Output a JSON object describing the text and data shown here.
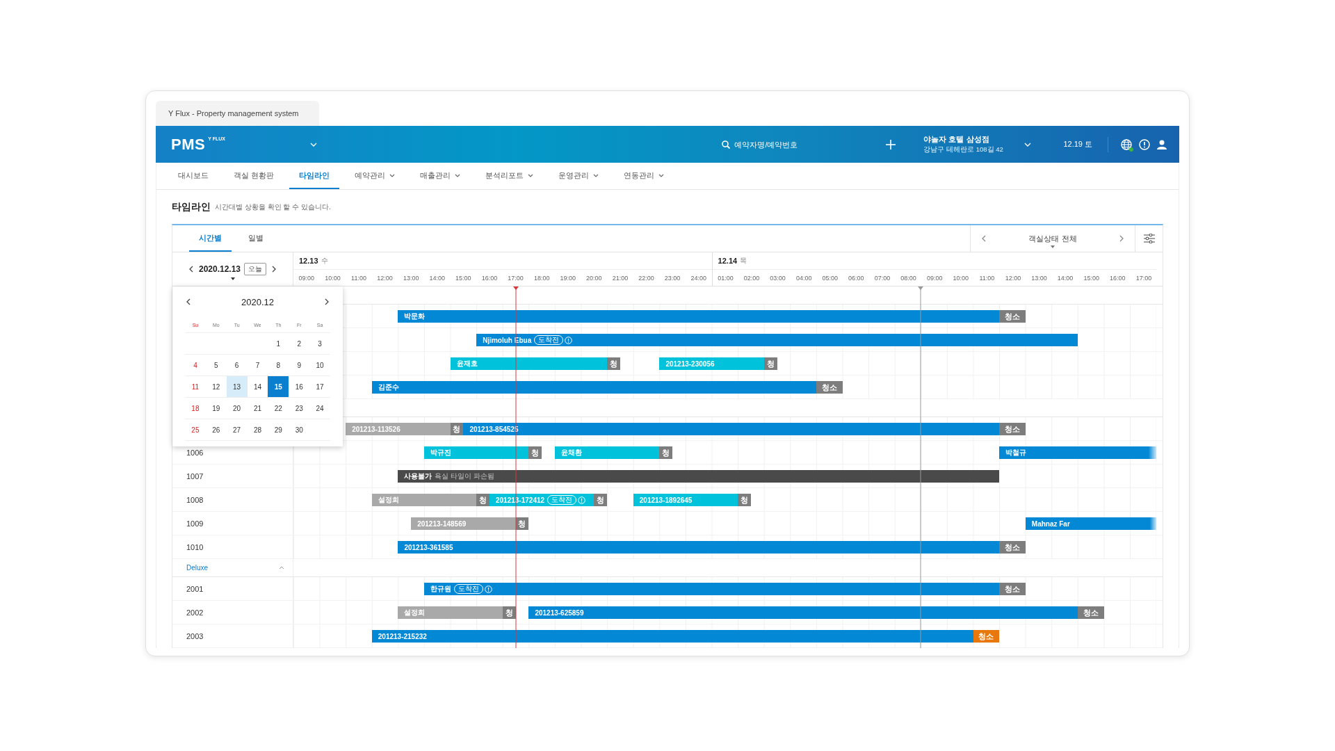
{
  "browser_tab": {
    "title": "Y Flux - Property management system"
  },
  "header": {
    "logo": "PMS",
    "logo_sub": "Y FLUX",
    "search": {
      "placeholder": "예약자명/예약번호"
    },
    "hotel": {
      "name": "야놀자 호텔 삼성점",
      "address": "강남구 테헤란로 108길 42"
    },
    "date": "12.19 토",
    "online": true
  },
  "nav": [
    {
      "label": "대시보드",
      "selected": false,
      "dropdown": false
    },
    {
      "label": "객실 현황판",
      "selected": false,
      "dropdown": false
    },
    {
      "label": "타임라인",
      "selected": true,
      "dropdown": false
    },
    {
      "label": "예약관리",
      "selected": false,
      "dropdown": true
    },
    {
      "label": "매출관리",
      "selected": false,
      "dropdown": true
    },
    {
      "label": "분석리포트",
      "selected": false,
      "dropdown": true
    },
    {
      "label": "운영관리",
      "selected": false,
      "dropdown": true
    },
    {
      "label": "연동관리",
      "selected": false,
      "dropdown": true
    }
  ],
  "page": {
    "title": "타임라인",
    "subtitle": "시간대별 상황을 확인 할 수 있습니다."
  },
  "view_tabs": [
    {
      "label": "시간별",
      "selected": true
    },
    {
      "label": "일별",
      "selected": false
    }
  ],
  "room_status_filter": {
    "label": "객실상태 전체"
  },
  "date_picker": {
    "date": "2020.12.13",
    "today_badge": "오늘",
    "calendar": {
      "month": "2020.12",
      "weekdays": [
        "Su",
        "Mo",
        "Tu",
        "We",
        "Th",
        "Fr",
        "Sa"
      ],
      "weeks": [
        [
          {
            "day": "1",
            "today": false,
            "selected": false
          },
          {
            "day": "2",
            "today": false,
            "selected": false
          },
          {
            "day": "3",
            "today": false,
            "selected": false
          }
        ],
        [
          {
            "day": "4",
            "today": false,
            "selected": false
          },
          {
            "day": "5",
            "today": false,
            "selected": false
          },
          {
            "day": "6",
            "today": false,
            "selected": false
          },
          {
            "day": "7",
            "today": false,
            "selected": false
          },
          {
            "day": "8",
            "today": false,
            "selected": false
          },
          {
            "day": "9",
            "today": false,
            "selected": false
          },
          {
            "day": "10",
            "today": false,
            "selected": false
          }
        ],
        [
          {
            "day": "11",
            "today": false,
            "selected": false
          },
          {
            "day": "12",
            "today": false,
            "selected": false
          },
          {
            "day": "13",
            "today": true,
            "selected": false
          },
          {
            "day": "14",
            "today": false,
            "selected": false
          },
          {
            "day": "15",
            "today": false,
            "selected": true
          },
          {
            "day": "16",
            "today": false,
            "selected": false
          },
          {
            "day": "17",
            "today": false,
            "selected": false
          }
        ],
        [
          {
            "day": "18",
            "today": false,
            "selected": false
          },
          {
            "day": "19",
            "today": false,
            "selected": false
          },
          {
            "day": "20",
            "today": false,
            "selected": false
          },
          {
            "day": "21",
            "today": false,
            "selected": false
          },
          {
            "day": "22",
            "today": false,
            "selected": false
          },
          {
            "day": "23",
            "today": false,
            "selected": false
          },
          {
            "day": "24",
            "today": false,
            "selected": false
          }
        ],
        [
          {
            "day": "25",
            "today": false,
            "selected": false
          },
          {
            "day": "26",
            "today": false,
            "selected": false
          },
          {
            "day": "27",
            "today": false,
            "selected": false
          },
          {
            "day": "28",
            "today": false,
            "selected": false
          },
          {
            "day": "29",
            "today": false,
            "selected": false
          },
          {
            "day": "30",
            "today": false,
            "selected": false
          }
        ]
      ]
    }
  },
  "days": [
    {
      "date": "12.13",
      "weekday": "수",
      "hours": [
        "09:00",
        "10:00",
        "11:00",
        "12:00",
        "13:00",
        "14:00",
        "15:00",
        "16:00",
        "17:00",
        "18:00",
        "19:00",
        "20:00",
        "21:00",
        "22:00",
        "23:00",
        "24:00"
      ]
    },
    {
      "date": "12.14",
      "weekday": "목",
      "hours": [
        "01:00",
        "02:00",
        "03:00",
        "04:00",
        "05:00",
        "06:00",
        "07:00",
        "08:00",
        "09:00",
        "10:00",
        "11:00",
        "12:00",
        "13:00",
        "14:00",
        "15:00",
        "16:00",
        "17:00"
      ]
    }
  ],
  "markers": [
    {
      "kind": "now"
    },
    {
      "kind": "reference"
    }
  ],
  "groups": [
    {
      "rows": [
        {
          "bars": [
            {
              "kind": "stay",
              "label": "박문화"
            },
            {
              "kind": "cleaning",
              "label": "청소",
              "active": false
            }
          ]
        },
        {
          "bars": [
            {
              "kind": "stay",
              "label": "Njimoluh Ebua",
              "badge": "도착전",
              "alert": true
            }
          ]
        },
        {
          "bars": [
            {
              "kind": "reserved",
              "label": "윤재호"
            },
            {
              "kind": "cleaning",
              "label": "청",
              "active": false
            },
            {
              "kind": "reserved",
              "label": "201213-230056"
            },
            {
              "kind": "cleaning",
              "label": "청",
              "active": false
            }
          ]
        },
        {
          "bars": [
            {
              "kind": "stay",
              "label": "김준수"
            },
            {
              "kind": "cleaning",
              "label": "청소",
              "active": false
            }
          ]
        }
      ]
    },
    {
      "rows": [
        {
          "bars": [
            {
              "kind": "checked_out",
              "label": "201213-113526"
            },
            {
              "kind": "cleaning",
              "label": "청",
              "active": false
            },
            {
              "kind": "stay",
              "label": "201213-854525"
            },
            {
              "kind": "cleaning",
              "label": "청소",
              "active": false
            }
          ]
        },
        {
          "room": "1006",
          "bars": [
            {
              "kind": "reserved",
              "label": "박규진"
            },
            {
              "kind": "cleaning",
              "label": "청",
              "active": false
            },
            {
              "kind": "reserved",
              "label": "윤채환"
            },
            {
              "kind": "cleaning",
              "label": "청",
              "active": false
            },
            {
              "kind": "stay",
              "label": "박철규",
              "continues": true
            }
          ]
        },
        {
          "room": "1007",
          "bars": [
            {
              "kind": "blocked",
              "label": "사용불가",
              "note": "욕실 타일이 파손됨"
            }
          ]
        },
        {
          "room": "1008",
          "bars": [
            {
              "kind": "checked_out",
              "label": "설정희"
            },
            {
              "kind": "cleaning",
              "label": "청",
              "active": false
            },
            {
              "kind": "reserved",
              "label": "201213-172412",
              "badge": "도착전",
              "alert": true
            },
            {
              "kind": "cleaning",
              "label": "청",
              "active": false
            },
            {
              "kind": "reserved",
              "label": "201213-1892645"
            },
            {
              "kind": "cleaning",
              "label": "청",
              "active": false
            }
          ]
        },
        {
          "room": "1009",
          "bars": [
            {
              "kind": "checked_out",
              "label": "201213-148569"
            },
            {
              "kind": "cleaning",
              "label": "청",
              "active": false
            },
            {
              "kind": "stay",
              "label": "Mahnaz Far",
              "continues": true
            }
          ]
        },
        {
          "room": "1010",
          "bars": [
            {
              "kind": "stay",
              "label": "201213-361585"
            },
            {
              "kind": "cleaning",
              "label": "청소",
              "active": false
            }
          ]
        }
      ]
    },
    {
      "name": "Deluxe",
      "expanded": true,
      "rows": [
        {
          "room": "2001",
          "bars": [
            {
              "kind": "stay",
              "label": "한규원",
              "badge": "도착전",
              "alert": true
            },
            {
              "kind": "cleaning",
              "label": "청소",
              "active": false
            }
          ]
        },
        {
          "room": "2002",
          "bars": [
            {
              "kind": "checked_out",
              "label": "설정희"
            },
            {
              "kind": "cleaning",
              "label": "청",
              "active": false
            },
            {
              "kind": "stay",
              "label": "201213-625859"
            },
            {
              "kind": "cleaning",
              "label": "청소",
              "active": false
            }
          ]
        },
        {
          "room": "2003",
          "bars": [
            {
              "kind": "stay",
              "label": "201213-215232"
            },
            {
              "kind": "cleaning",
              "label": "청소",
              "active": true
            }
          ]
        }
      ]
    }
  ]
}
